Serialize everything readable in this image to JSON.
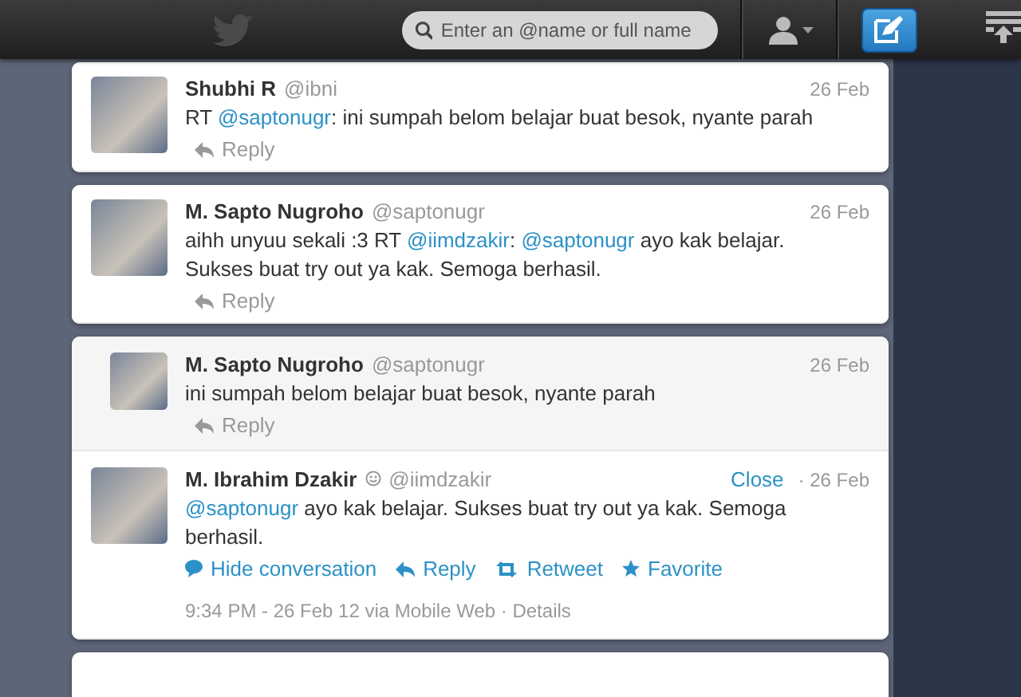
{
  "top_bar": {
    "search": {
      "placeholder": "Enter an @name or full name"
    }
  },
  "cards": [
    {
      "tweets": [
        {
          "kind": "stream",
          "name": "Shubhi R",
          "handle": "@ibni",
          "date": "26 Feb",
          "text": [
            {
              "kind": "plain",
              "text": "RT "
            },
            {
              "kind": "mention",
              "text": "@saptonugr"
            },
            {
              "kind": "plain",
              "text": ": ini sumpah belom belajar buat besok, nyante parah"
            }
          ],
          "actions": [
            {
              "kind": "reply",
              "label": "Reply"
            }
          ]
        }
      ]
    },
    {
      "tweets": [
        {
          "kind": "stream",
          "name": "M. Sapto Nugroho",
          "handle": "@saptonugr",
          "date": "26 Feb",
          "text": [
            {
              "kind": "plain",
              "text": "aihh unyuu sekali :3 RT "
            },
            {
              "kind": "mention",
              "text": "@iimdzakir"
            },
            {
              "kind": "plain",
              "text": ": "
            },
            {
              "kind": "mention",
              "text": "@saptonugr"
            },
            {
              "kind": "plain",
              "text": " ayo kak belajar. Sukses buat try out ya kak. Semoga berhasil."
            }
          ],
          "actions": [
            {
              "kind": "reply",
              "label": "Reply"
            }
          ]
        }
      ]
    },
    {
      "tweets": [
        {
          "kind": "context",
          "name": "M. Sapto Nugroho",
          "handle": "@saptonugr",
          "date": "26 Feb",
          "text": [
            {
              "kind": "plain",
              "text": "ini sumpah belom belajar buat besok, nyante parah"
            }
          ],
          "actions": [
            {
              "kind": "reply",
              "label": "Reply"
            }
          ]
        },
        {
          "kind": "expanded",
          "name": "M. Ibrahim Dzakir",
          "emoji_icon": true,
          "handle": "@iimdzakir",
          "close": "Close",
          "date": "· 26 Feb",
          "text": [
            {
              "kind": "mention",
              "text": "@saptonugr"
            },
            {
              "kind": "plain",
              "text": " ayo kak belajar. Sukses buat try out ya kak. Semoga berhasil."
            }
          ],
          "actions": [
            {
              "kind": "conversation",
              "label": "Hide conversation"
            },
            {
              "kind": "reply",
              "label": "Reply"
            },
            {
              "kind": "retweet",
              "label": "Retweet"
            },
            {
              "kind": "favorite",
              "label": "Favorite"
            }
          ],
          "meta": "9:34 PM - 26 Feb 12 via Mobile Web ·",
          "details": "Details"
        }
      ]
    }
  ]
}
